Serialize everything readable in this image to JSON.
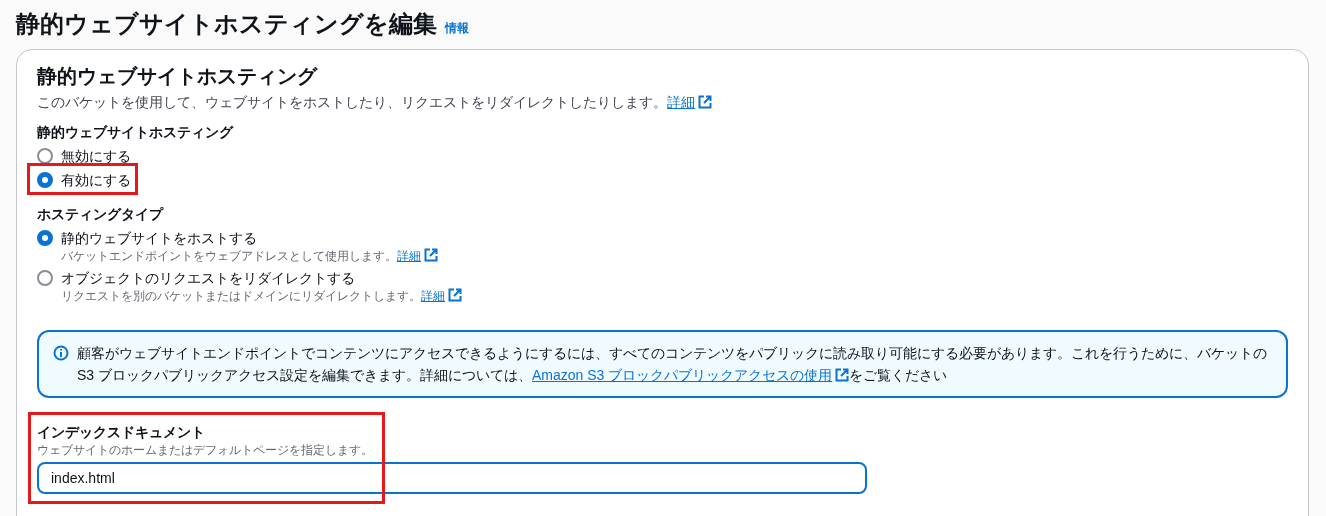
{
  "page": {
    "title": "静的ウェブサイトホスティングを編集",
    "info_link": "情報"
  },
  "card": {
    "title": "静的ウェブサイトホスティング",
    "description": "このバケットを使用して、ウェブサイトをホストしたり、リクエストをリダイレクトしたりします。",
    "description_link": "詳細",
    "hosting": {
      "label": "静的ウェブサイトホスティング",
      "options": [
        {
          "label": "無効にする",
          "selected": false,
          "highlighted": false
        },
        {
          "label": "有効にする",
          "selected": true,
          "highlighted": true
        }
      ]
    },
    "hosting_type": {
      "label": "ホスティングタイプ",
      "options": [
        {
          "label": "静的ウェブサイトをホストする",
          "hint": "バケットエンドポイントをウェブアドレスとして使用します。",
          "link": "詳細",
          "selected": true
        },
        {
          "label": "オブジェクトのリクエストをリダイレクトする",
          "hint": "リクエストを別のバケットまたはドメインにリダイレクトします。",
          "link": "詳細",
          "selected": false
        }
      ]
    },
    "alert": {
      "text_before": "顧客がウェブサイトエンドポイントでコンテンツにアクセスできるようにするには、すべてのコンテンツをパブリックに読み取り可能にする必要があります。これを行うために、バケットの S3 ブロックパブリックアクセス設定を編集できます。詳細については、",
      "link": "Amazon S3 ブロックパブリックアクセスの使用",
      "text_after": "をご覧ください"
    },
    "index_document": {
      "label": "インデックスドキュメント",
      "hint": "ウェブサイトのホームまたはデフォルトページを指定します。",
      "value": "index.html",
      "highlighted": true
    }
  }
}
